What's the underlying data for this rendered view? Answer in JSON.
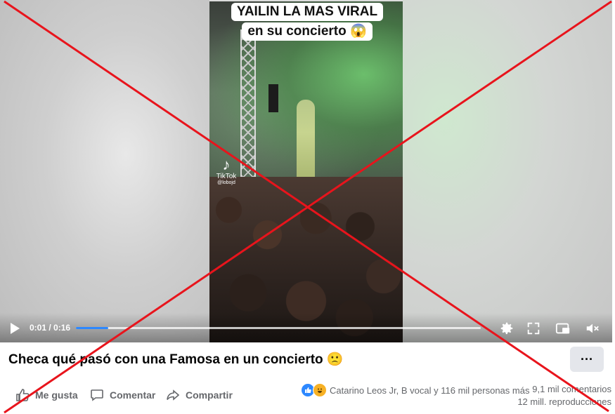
{
  "video": {
    "caption_line1": "YAILIN LA MAS VIRAL",
    "caption_line2": "en su concierto 😱",
    "watermark_brand": "TikTok",
    "watermark_handle": "@lobojd",
    "time_text": "0:01 / 0:16",
    "progress": 0.08,
    "accent_color": "#2d88ff"
  },
  "controls": {
    "icons": [
      "play-icon",
      "settings-icon",
      "fullscreen-icon",
      "picture-in-picture-icon",
      "volume-muted-icon"
    ]
  },
  "overlay": {
    "mark": "cross-out-x",
    "color": "#e8141c"
  },
  "post": {
    "title": "Checa qué pasó con una Famosa en un concierto 🙁",
    "more_label": "···"
  },
  "actions": {
    "like_label": "Me gusta",
    "comment_label": "Comentar",
    "share_label": "Compartir"
  },
  "reactions": {
    "icons": [
      "like-reaction-icon",
      "haha-reaction-icon"
    ],
    "summary": "Catarino Leos Jr, B vocal y 116 mil personas más"
  },
  "stats": {
    "comments": "9,1 mil comentarios",
    "views": "12 mill. reproducciones"
  }
}
